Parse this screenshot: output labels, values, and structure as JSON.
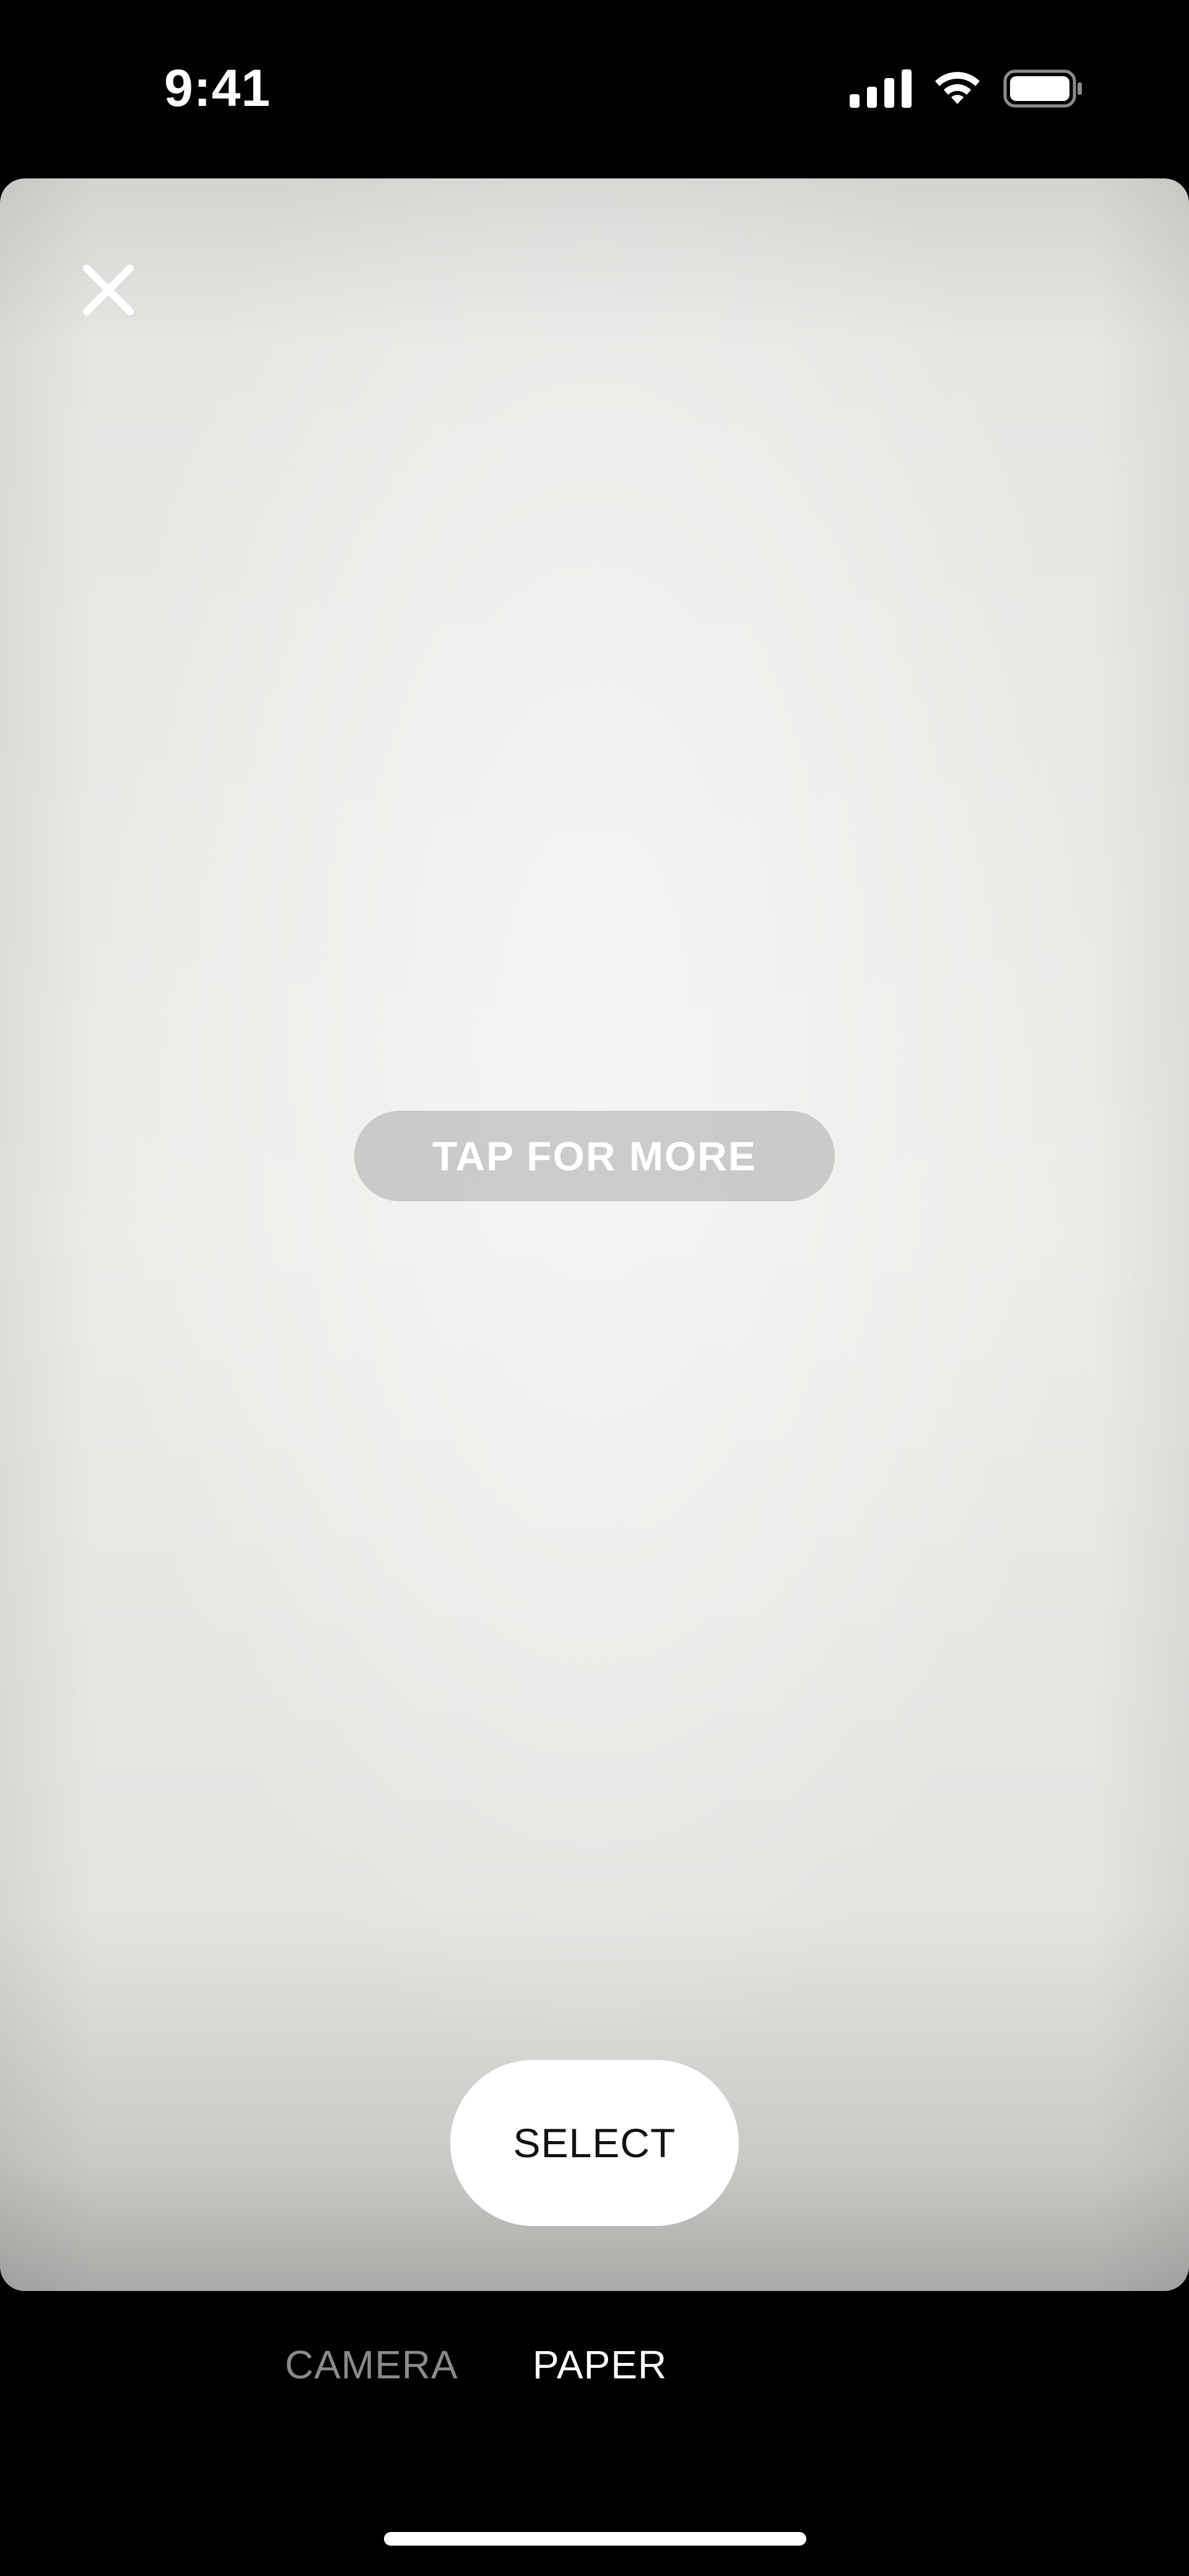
{
  "status_bar": {
    "time": "9:41",
    "icons": [
      "cellular-signal-icon",
      "wifi-icon",
      "battery-icon"
    ]
  },
  "paper_view": {
    "close_icon": "close-icon",
    "tap_hint": "TAP FOR MORE",
    "select_label": "SELECT"
  },
  "mode_tabs": {
    "items": [
      {
        "label": "CAMERA",
        "active": false
      },
      {
        "label": "PAPER",
        "active": true
      }
    ]
  },
  "colors": {
    "background": "#000000",
    "active_tab": "#ffffff",
    "inactive_tab": "#8a8a8a",
    "select_button": "#ffffff"
  }
}
